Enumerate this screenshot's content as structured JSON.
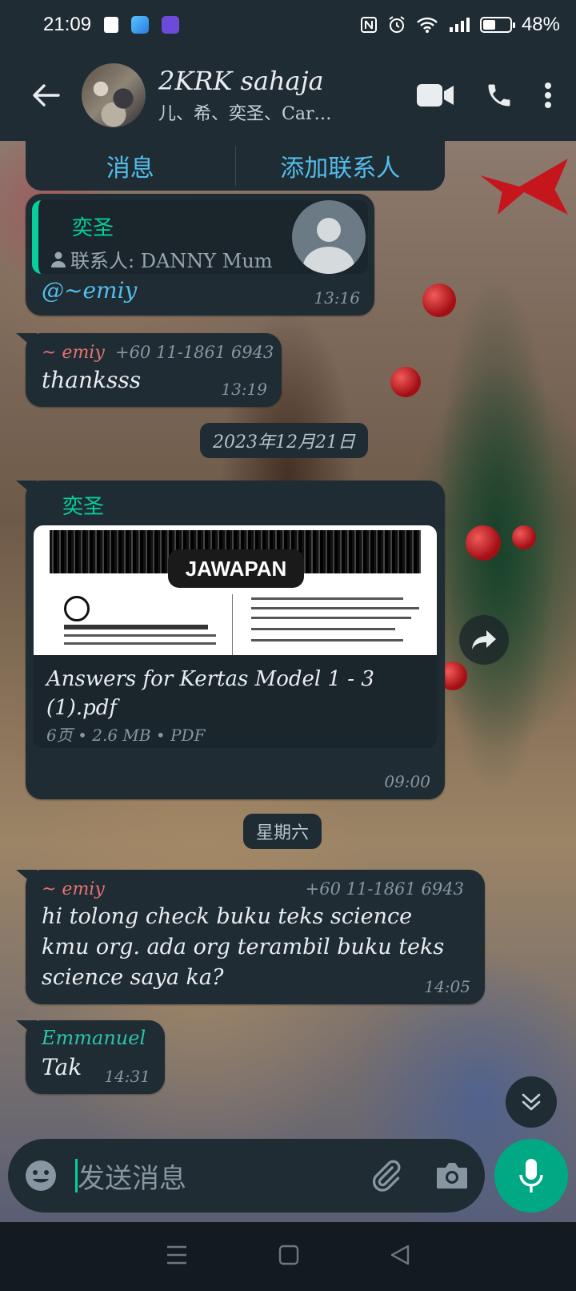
{
  "status_bar": {
    "time": "21:09",
    "battery": "48%",
    "battery_level": 0.48
  },
  "header": {
    "title": "2KRK sahaja",
    "subtitle": "儿、希、奕圣、Car…"
  },
  "contact_actions": {
    "message": "消息",
    "add_contact": "添加联系人"
  },
  "messages": [
    {
      "sender": "奕圣",
      "contact_label": "联系人: DANNY Mum",
      "mention": "@~emiy",
      "time": "13:16"
    },
    {
      "sender": "~ emiy",
      "phone": "+60 11-1861 6943",
      "text": "thanksss",
      "time": "13:19"
    },
    {
      "sender": "奕圣",
      "document": {
        "preview_label": "JAWAPAN",
        "filename": "Answers for Kertas Model 1 - 3 (1).pdf",
        "meta": "6页 • 2.6 MB • PDF"
      },
      "time": "09:00"
    },
    {
      "sender": "~ emiy",
      "phone": "+60 11-1861 6943",
      "text": "hi tolong check buku teks science kmu org. ada org terambil buku teks science saya ka?",
      "time": "14:05"
    },
    {
      "sender": "Emmanuel",
      "text": "Tak",
      "time": "14:31"
    }
  ],
  "date_separators": [
    "2023年12月21日",
    "星期六"
  ],
  "composer": {
    "placeholder": "发送消息"
  },
  "colors": {
    "bubble": "#1f2c34",
    "accent": "#00a884",
    "link": "#53bdeb"
  }
}
